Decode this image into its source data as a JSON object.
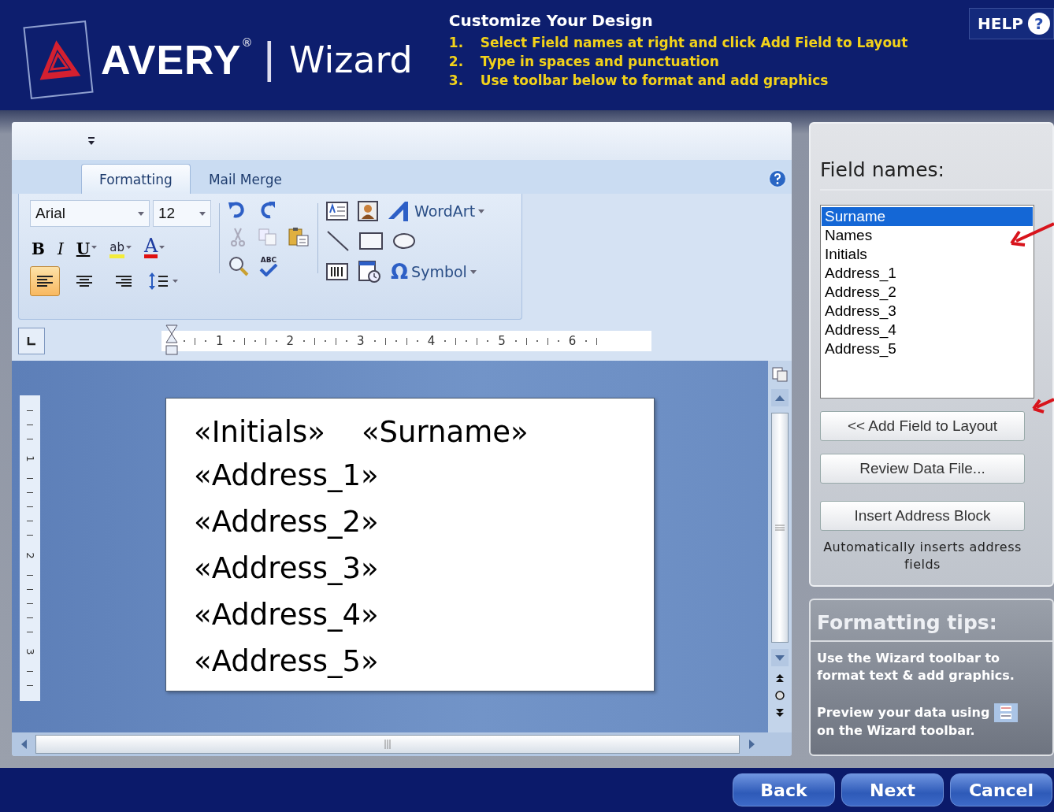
{
  "header": {
    "brand": "AVERY",
    "registered": "®",
    "separator": "|",
    "product": "Wizard",
    "instructions_title": "Customize Your Design",
    "steps": [
      {
        "number": "1.",
        "text": "Select Field names at right and click Add Field to Layout"
      },
      {
        "number": "2.",
        "text": "Type in spaces and punctuation"
      },
      {
        "number": "3.",
        "text": "Use toolbar below to format and add graphics"
      }
    ],
    "help": "HELP",
    "help_glyph": "?"
  },
  "ribbon": {
    "tabs": [
      {
        "label": "Formatting",
        "selected": true
      },
      {
        "label": "Mail Merge",
        "selected": false
      }
    ],
    "font": "Arial",
    "font_size": "12",
    "format_buttons": [
      {
        "kind": "bold",
        "glyph": "B"
      },
      {
        "kind": "italic",
        "glyph": "I"
      },
      {
        "kind": "underline",
        "glyph": "U"
      },
      {
        "kind": "highlight",
        "glyph": "ab"
      },
      {
        "kind": "font-color",
        "glyph": "A"
      }
    ],
    "align_buttons": [
      {
        "kind": "left",
        "selected": true
      },
      {
        "kind": "center",
        "selected": false
      },
      {
        "kind": "right",
        "selected": false
      }
    ],
    "spell_glyph": "ABC",
    "wordart": "WordArt",
    "symbol_glyph": "Ω",
    "symbol": "Symbol"
  },
  "ruler": {
    "numbers": [
      "1",
      "2",
      "3",
      "4",
      "5",
      "6"
    ]
  },
  "vertical_ruler": {
    "numbers": [
      "1",
      "2",
      "3"
    ]
  },
  "document": {
    "lines": [
      [
        "«Initials»",
        "«Surname»"
      ],
      [
        "«Address_1»"
      ],
      [
        "«Address_2»"
      ],
      [
        "«Address_3»"
      ],
      [
        "«Address_4»"
      ],
      [
        "«Address_5»"
      ]
    ]
  },
  "field_panel": {
    "title": "Field names:",
    "fields": [
      {
        "label": "Surname",
        "selected": true
      },
      {
        "label": "Names",
        "selected": false
      },
      {
        "label": "Initials",
        "selected": false
      },
      {
        "label": "Address_1",
        "selected": false
      },
      {
        "label": "Address_2",
        "selected": false
      },
      {
        "label": "Address_3",
        "selected": false
      },
      {
        "label": "Address_4",
        "selected": false
      },
      {
        "label": "Address_5",
        "selected": false
      }
    ],
    "buttons": [
      "<< Add Field to Layout",
      "Review Data File...",
      "Insert Address Block"
    ],
    "note": "Automatically inserts address fields"
  },
  "tips": {
    "title": "Formatting tips:",
    "text": "Use the Wizard toolbar to format text & add graphics.",
    "preview_before": "Preview your data using",
    "preview_after": "on the Wizard toolbar."
  },
  "nav_buttons": [
    "Back",
    "Next",
    "Cancel"
  ]
}
